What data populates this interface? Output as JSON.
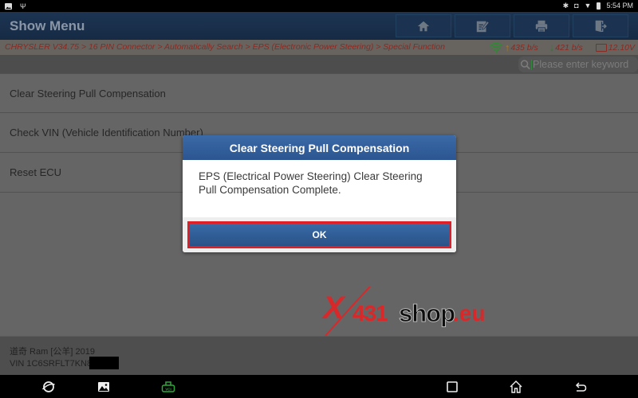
{
  "status_bar": {
    "left_icons": [
      "image-notification-icon",
      "usb-icon"
    ],
    "right_icons": [
      "bluetooth-icon",
      "vibrate-icon",
      "wifi-icon",
      "battery-icon"
    ],
    "time": "5:54 PM"
  },
  "header": {
    "title": "Show Menu",
    "toolbar": [
      {
        "name": "home",
        "icon": "home-icon"
      },
      {
        "name": "report",
        "icon": "edit-report-icon"
      },
      {
        "name": "print",
        "icon": "printer-icon"
      },
      {
        "name": "exit",
        "icon": "exit-door-icon"
      }
    ]
  },
  "breadcrumb": {
    "path": "CHRYSLER V34.75 > 16 PIN Connector > Automatically Search > EPS (Electronic Power Steering) > Special Function",
    "upload_rate": "435 b/s",
    "download_rate": "421 b/s",
    "voltage": "12.10V"
  },
  "search": {
    "placeholder": "Please enter keyword",
    "value": ""
  },
  "menu": {
    "items": [
      {
        "label": "Clear Steering Pull Compensation"
      },
      {
        "label": "Check VIN (Vehicle Identification Number)"
      },
      {
        "label": "Reset ECU"
      }
    ]
  },
  "vehicle_info": {
    "model": "道奇 Ram [公羊] 2019",
    "vin": "VIN 1C6SRFLT7KN8"
  },
  "dialog": {
    "title": "Clear Steering Pull Compensation",
    "message": "EPS (Electrical Power Steering) Clear Steering Pull Compensation Complete.",
    "ok_label": "OK",
    "highlight_color": "#e01e26"
  },
  "watermark": {
    "x": "X",
    "num": "431",
    "shop": "shop",
    "tld": ".eu"
  },
  "nav_bar": {
    "buttons": [
      "browser-icon",
      "gallery-icon",
      "vci-icon",
      "recent-apps-icon",
      "home-icon",
      "back-icon"
    ],
    "vci_label": "VCI"
  },
  "colors": {
    "header_bg": "#1d3553",
    "dialog_title_bg": "#3b6aa8",
    "breadcrumb_text": "#8a2a22",
    "vci_green": "#2fa83a"
  }
}
